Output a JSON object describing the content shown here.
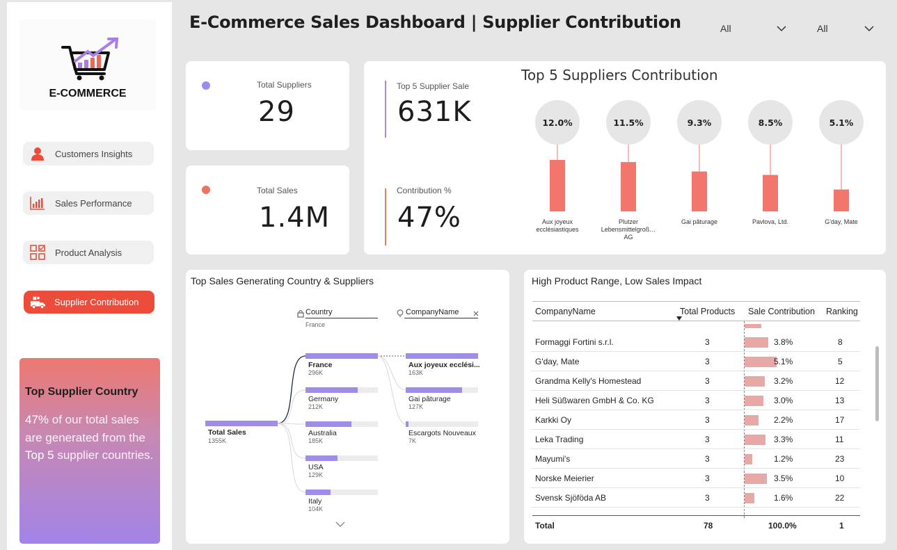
{
  "header": {
    "title": "E-Commerce Sales Dashboard | Supplier Contribution",
    "slicers": [
      {
        "value": "All"
      },
      {
        "value": "All"
      }
    ]
  },
  "sidebar": {
    "logo_text": "E-COMMERCE",
    "nav": [
      {
        "label": "Customers Insights",
        "icon": "person-icon",
        "active": false
      },
      {
        "label": "Sales Performance",
        "icon": "bar-chart-icon",
        "active": false
      },
      {
        "label": "Product Analysis",
        "icon": "grid-icon",
        "active": false
      },
      {
        "label": "Supplier Contribution",
        "icon": "truck-icon",
        "active": true
      }
    ],
    "insight": {
      "title": "Top Supplier Country",
      "pct": "47%",
      "text1": " of our total sales are generated from the ",
      "highlight": "Top 5",
      "text2": " supplier countries."
    }
  },
  "kpis": {
    "total_suppliers": {
      "label": "Total Suppliers",
      "value": "29",
      "color": "#9c8cf0"
    },
    "total_sales": {
      "label": "Total Sales",
      "value": "1.4M",
      "color": "#f07262"
    },
    "top5_sale": {
      "label": "Top 5 Supplier Sale",
      "value": "631K",
      "color": "#9c8cf0"
    },
    "contribution": {
      "label": "Contribution %",
      "value": "47%",
      "color": "#f07262"
    }
  },
  "chart_data": {
    "type": "bar",
    "title": "Top 5 Suppliers Contribution",
    "categories": [
      "Aux joyeux ecclésiastiques",
      "Plutzer Lebensmittelgroß…AG",
      "Gai pâturage",
      "Pavlova, Ltd.",
      "G'day, Mate"
    ],
    "category_lines": [
      [
        "Aux joyeux",
        "ecclésiastiques"
      ],
      [
        "Plutzer",
        "Lebensmittelgroß…",
        "AG"
      ],
      [
        "Gai pâturage"
      ],
      [
        "Pavlova, Ltd."
      ],
      [
        "G'day, Mate"
      ]
    ],
    "values": [
      12.0,
      11.5,
      9.3,
      8.5,
      5.1
    ],
    "labels": [
      "12.0%",
      "11.5%",
      "9.3%",
      "8.5%",
      "5.1%"
    ],
    "ylim": [
      0,
      12.0
    ],
    "bar_color": "#f2766b"
  },
  "decomp": {
    "title": "Top Sales Generating Country & Suppliers",
    "col1": {
      "header": "Country",
      "sub": "France"
    },
    "col2": {
      "header": "CompanyName"
    },
    "root": {
      "label": "Total Sales",
      "value": "1355K"
    },
    "countries": [
      {
        "label": "France",
        "value": "296K",
        "frac": 1.0,
        "bold": true
      },
      {
        "label": "Germany",
        "value": "212K",
        "frac": 0.72,
        "bold": false
      },
      {
        "label": "Australia",
        "value": "185K",
        "frac": 0.63,
        "bold": false
      },
      {
        "label": "USA",
        "value": "129K",
        "frac": 0.44,
        "bold": false
      },
      {
        "label": "Italy",
        "value": "104K",
        "frac": 0.35,
        "bold": false
      }
    ],
    "companies": [
      {
        "label": "Aux joyeux ecclési...",
        "value": "163K",
        "frac": 1.0,
        "bold": true
      },
      {
        "label": "Gai pâturage",
        "value": "127K",
        "frac": 0.78,
        "bold": false
      },
      {
        "label": "Escargots Nouveaux",
        "value": "7K",
        "frac": 0.04,
        "bold": false
      }
    ]
  },
  "table": {
    "title": "High Product Range, Low Sales Impact",
    "columns": [
      "CompanyName",
      "Total Products",
      "Sale Contribution",
      "Ranking"
    ],
    "rows": [
      {
        "name": "Formaggi Fortini s.r.l.",
        "products": "3",
        "contribution": "3.8%",
        "pct": 3.8,
        "rank": "8"
      },
      {
        "name": "G'day, Mate",
        "products": "3",
        "contribution": "5.1%",
        "pct": 5.1,
        "rank": "5"
      },
      {
        "name": "Grandma Kelly's Homestead",
        "products": "3",
        "contribution": "3.2%",
        "pct": 3.2,
        "rank": "12"
      },
      {
        "name": "Heli Süßwaren GmbH & Co. KG",
        "products": "3",
        "contribution": "3.0%",
        "pct": 3.0,
        "rank": "13"
      },
      {
        "name": "Karkki Oy",
        "products": "3",
        "contribution": "2.2%",
        "pct": 2.2,
        "rank": "17"
      },
      {
        "name": "Leka Trading",
        "products": "3",
        "contribution": "3.3%",
        "pct": 3.3,
        "rank": "11"
      },
      {
        "name": "Mayumi's",
        "products": "3",
        "contribution": "1.2%",
        "pct": 1.2,
        "rank": "23"
      },
      {
        "name": "Norske Meierier",
        "products": "3",
        "contribution": "3.5%",
        "pct": 3.5,
        "rank": "10"
      },
      {
        "name": "Svensk Sjöföda AB",
        "products": "3",
        "contribution": "1.6%",
        "pct": 1.6,
        "rank": "22"
      }
    ],
    "total": {
      "label": "Total",
      "products": "78",
      "contribution": "100.0%",
      "rank": "1"
    }
  }
}
